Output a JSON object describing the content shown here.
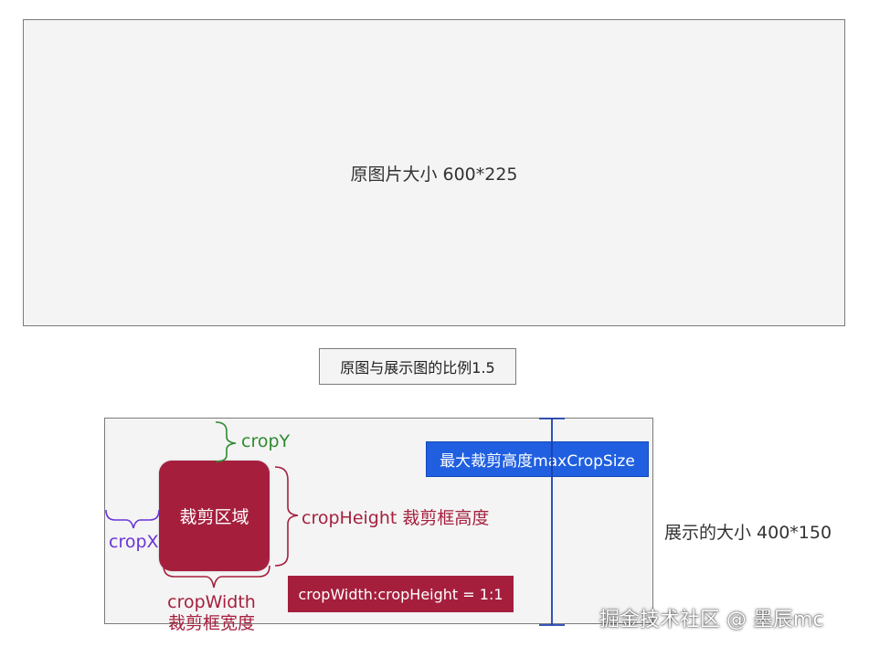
{
  "original": {
    "label": "原图片大小 600*225"
  },
  "ratio_note": "原图与展示图的比例1.5",
  "display": {
    "size_label": "展示的大小 400*150"
  },
  "crop_area": {
    "label": "裁剪区域"
  },
  "labels": {
    "cropY": "cropY",
    "cropX": "cropX",
    "cropHeight": "cropHeight 裁剪框高度",
    "cropWidth_line1": "cropWidth",
    "cropWidth_line2": "裁剪框宽度"
  },
  "max_crop_size": "最大裁剪高度maxCropSize",
  "aspect_ratio_tag": "cropWidth:cropHeight = 1:1",
  "watermark": "掘金技术社区 @ 墨辰mc",
  "colors": {
    "crop_red": "#a51f3d",
    "blue": "#1f5fe0",
    "green": "#2e8b2e",
    "purple": "#6a35d6",
    "box_gray": "#f4f4f4"
  }
}
